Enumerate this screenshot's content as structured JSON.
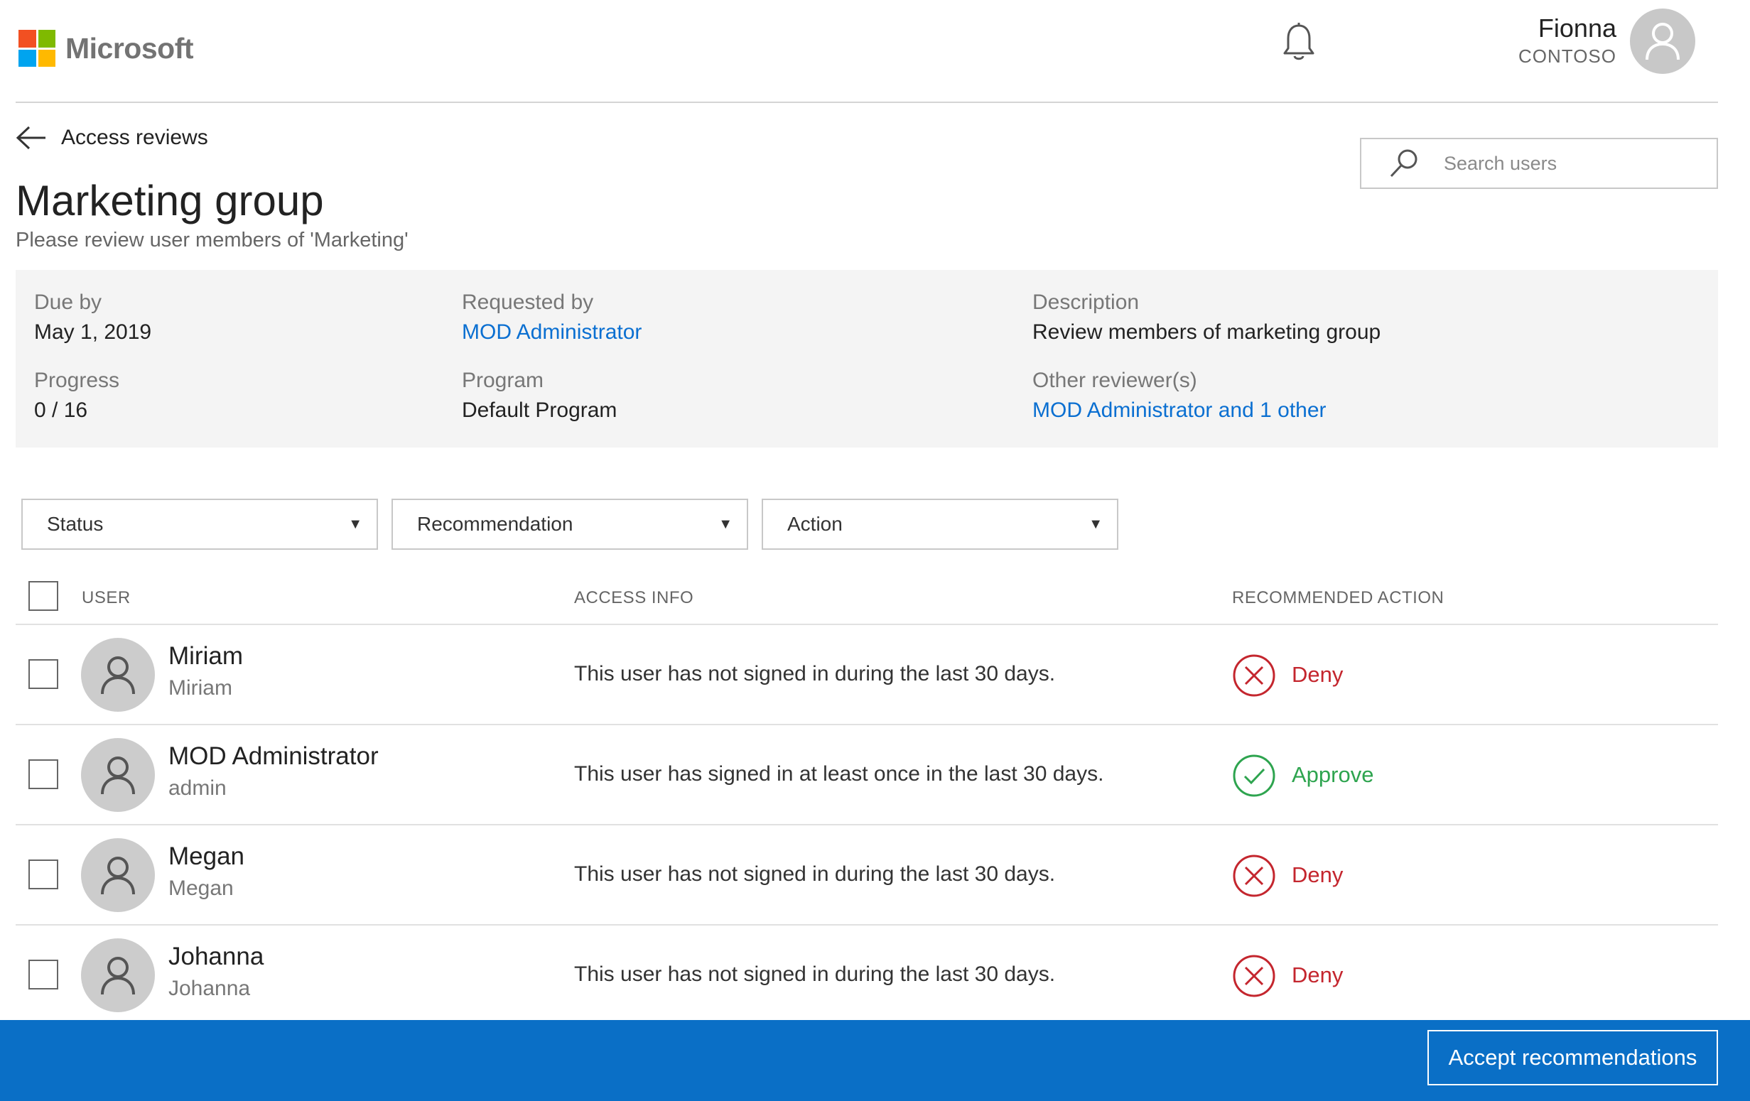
{
  "header": {
    "brand": "Microsoft",
    "logo_colors": [
      "#f25022",
      "#7fba00",
      "#00a4ef",
      "#ffb900"
    ],
    "notification_icon": "bell-icon",
    "user": {
      "name": "Fionna",
      "org": "CONTOSO",
      "avatar_icon": "person-icon"
    }
  },
  "nav": {
    "back_label": "Access reviews",
    "back_icon": "arrow-left-icon"
  },
  "page": {
    "title": "Marketing group",
    "subtitle": "Please review user members of 'Marketing'"
  },
  "search": {
    "placeholder": "Search users",
    "icon": "search-icon"
  },
  "info": {
    "due_by": {
      "label": "Due by",
      "value": "May 1, 2019"
    },
    "progress": {
      "label": "Progress",
      "value": "0 / 16"
    },
    "requested_by": {
      "label": "Requested by",
      "value": "MOD Administrator"
    },
    "program": {
      "label": "Program",
      "value": "Default Program"
    },
    "description": {
      "label": "Description",
      "value": "Review members of marketing group"
    },
    "other_reviewers": {
      "label": "Other reviewer(s)",
      "value": "MOD Administrator and 1 other"
    }
  },
  "filters": {
    "status": "Status",
    "recommendation": "Recommendation",
    "action": "Action",
    "caret": "▼"
  },
  "table": {
    "columns": {
      "user": "USER",
      "access_info": "ACCESS INFO",
      "recommended_action": "RECOMMENDED ACTION"
    },
    "rows": [
      {
        "name": "Miriam",
        "alias": "Miriam",
        "access_info": "This user has not signed in during the last 30 days.",
        "recommendation": "Deny"
      },
      {
        "name": "MOD Administrator",
        "alias": "admin",
        "access_info": "This user has signed in at least once in the last 30 days.",
        "recommendation": "Approve"
      },
      {
        "name": "Megan",
        "alias": "Megan",
        "access_info": "This user has not signed in during the last 30 days.",
        "recommendation": "Deny"
      },
      {
        "name": "Johanna",
        "alias": "Johanna",
        "access_info": "This user has not signed in during the last 30 days.",
        "recommendation": "Deny"
      }
    ]
  },
  "colors": {
    "link": "#0a6fd1",
    "deny": "#c4262e",
    "approve": "#2ea44f",
    "footer": "#0a6fc6"
  },
  "footer": {
    "accept_label": "Accept recommendations"
  }
}
